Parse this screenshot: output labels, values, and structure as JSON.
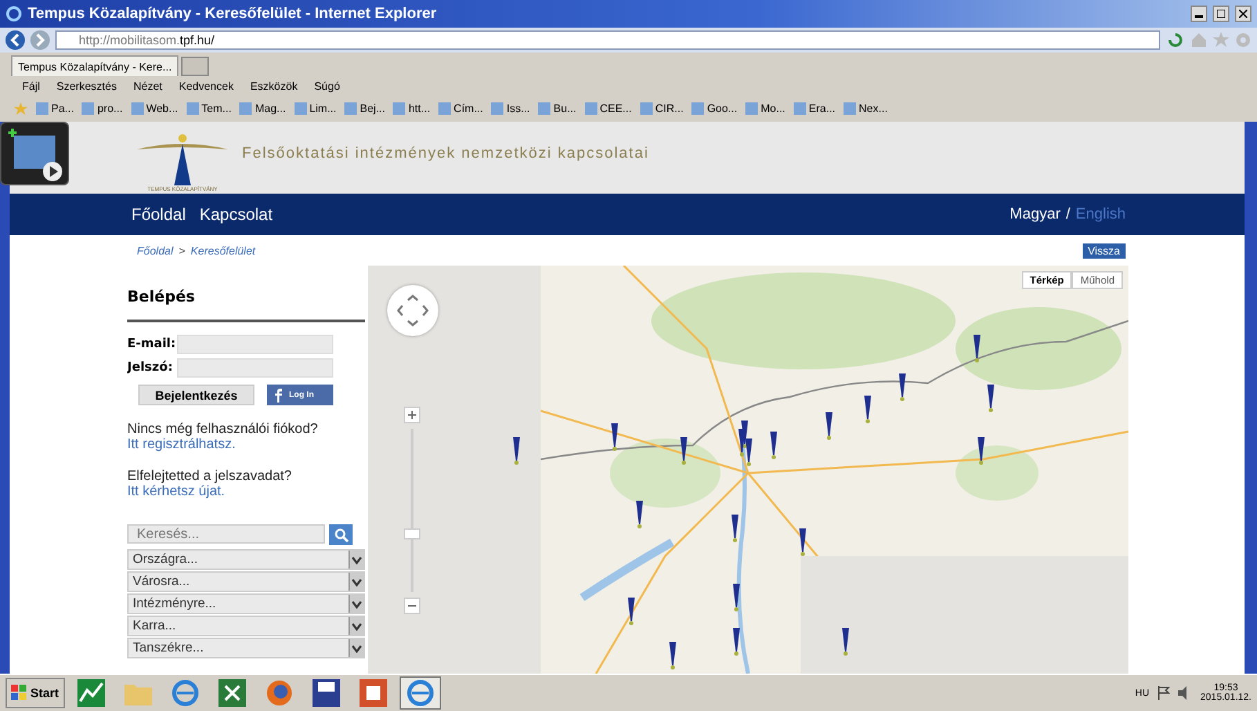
{
  "window": {
    "title": "Tempus Közalapítvány - Keresőfelület - Internet Explorer"
  },
  "address_bar": {
    "url_prefix": "http://mobilitasom.",
    "url_domain": "tpf.hu/"
  },
  "tabs": [
    {
      "label": "Tempus Közalapítvány - Kere...",
      "selected": true
    }
  ],
  "menu": [
    "Fájl",
    "Szerkesztés",
    "Nézet",
    "Kedvencek",
    "Eszközök",
    "Súgó"
  ],
  "favorites": [
    "Pa...",
    "pro...",
    "Web...",
    "Tem...",
    "Mag...",
    "Lim...",
    "Bej...",
    "htt...",
    "Cím...",
    "Iss...",
    "Bu...",
    "CEE...",
    "CIR...",
    "Goo...",
    "Mo...",
    "Era...",
    "Nex..."
  ],
  "header": {
    "logo_caption": "TEMPUS KÖZALAPÍTVÁNY",
    "tagline": "Felsőoktatási intézmények nemzetközi kapcsolatai"
  },
  "nav": {
    "links": [
      "Főoldal",
      "Kapcsolat"
    ],
    "separator": "/",
    "languages": [
      {
        "label": "Magyar",
        "selected": true
      },
      {
        "label": "English",
        "selected": false
      }
    ]
  },
  "breadcrumb": {
    "items": [
      "Főoldal",
      "Keresőfelület"
    ],
    "separator": ">"
  },
  "back_button": "Vissza",
  "login": {
    "title": "Belépés",
    "fields": [
      {
        "label": "E-mail:"
      },
      {
        "label": "Jelszó:"
      }
    ],
    "submit": "Bejelentkezés",
    "facebook": "Log In",
    "register_text": "Nincs még felhasználói fiókod?",
    "register_link": "Itt regisztrálhatsz.",
    "forgot_text": "Elfelejtetted a jelszavadat?",
    "forgot_link": "Itt kérhetsz újat."
  },
  "search": {
    "placeholder": "Keresés..."
  },
  "filters": [
    "Országra...",
    "Városra...",
    "Intézményre...",
    "Karra...",
    "Tanszékre..."
  ],
  "map": {
    "zoom": {
      "level": 0.35
    },
    "types": [
      {
        "label": "Térkép",
        "selected": true
      },
      {
        "label": "Műhold",
        "selected": false
      }
    ]
  },
  "taskbar": {
    "start": "Start",
    "apps": [
      {
        "kind": "chart",
        "selected": false
      },
      {
        "kind": "folder",
        "selected": false
      },
      {
        "kind": "ie",
        "selected": false
      },
      {
        "kind": "excel",
        "selected": false
      },
      {
        "kind": "firefox",
        "selected": false
      },
      {
        "kind": "disk",
        "selected": false
      },
      {
        "kind": "powerpoint",
        "selected": false
      },
      {
        "kind": "ie",
        "selected": true
      }
    ],
    "language": "HU",
    "time": "19:53",
    "date": "2015.01.12."
  }
}
